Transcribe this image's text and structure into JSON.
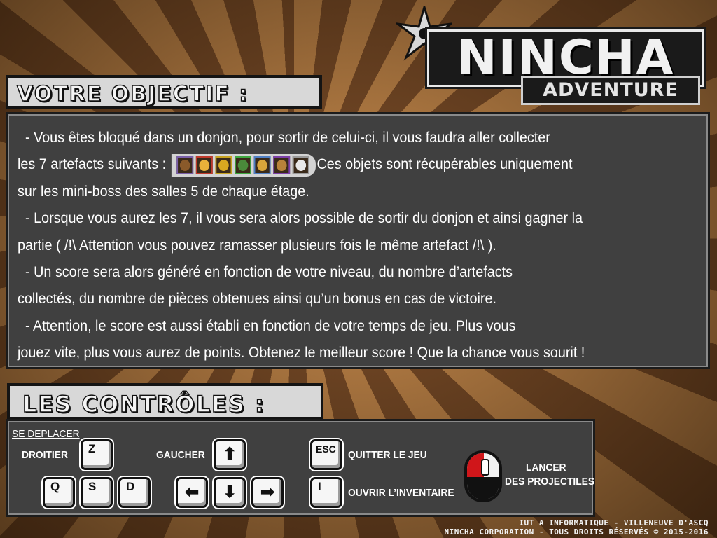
{
  "logo": {
    "title": "NINCHA",
    "subtitle": "ADVENTURE"
  },
  "objectif": {
    "heading": "VOTRE OBJECTIF :",
    "line1": "- Vous êtes bloqué dans un donjon, pour sortir de celui-ci, il vous faudra aller collecter",
    "line2_before": "les 7 artefacts suivants :",
    "line2_after": "Ces objets sont récupérables uniquement",
    "line3": "sur les mini-boss des salles 5 de chaque étage.",
    "line4": "- Lorsque vous aurez les 7, il vous sera alors possible de sortir du donjon et ainsi gagner la",
    "line5": "partie ( /!\\ Attention vous pouvez ramasser plusieurs fois le même artefact /!\\ ).",
    "line6": "- Un score sera alors généré en fonction de votre niveau, du nombre d’artefacts",
    "line7": "collectés, du nombre de pièces obtenues ainsi qu’un bonus en cas de victoire.",
    "line8": "- Attention, le score est aussi établi en fonction de votre temps de jeu. Plus vous",
    "line9": "jouez vite, plus vous aurez de points. Obtenez le meilleur score ! Que la chance vous sourit !",
    "artefacts": [
      {
        "icon": "teddy-bear-icon",
        "border": "#7a5fa8",
        "color": "#8a5a2a"
      },
      {
        "icon": "lantern-icon",
        "border": "#c0392b",
        "color": "#e8b13a"
      },
      {
        "icon": "key-icon",
        "border": "#c7a21f",
        "color": "#d8a820"
      },
      {
        "icon": "emblem-icon",
        "border": "#3fa73f",
        "color": "#4a8a3a"
      },
      {
        "icon": "crest-icon",
        "border": "#4f7fc4",
        "color": "#d9a53a"
      },
      {
        "icon": "rope-icon",
        "border": "#7c3fa8",
        "color": "#b8823a"
      },
      {
        "icon": "mask-icon",
        "border": "#9a9a9a",
        "color": "#e8e8e8"
      }
    ]
  },
  "controles": {
    "heading": "LES CONTRÔLES :",
    "move_label": "SE DEPLACER",
    "right_label": "DROITIER",
    "left_label": "GAUCHER",
    "quit_label": "QUITTER LE JEU",
    "inventory_label": "OUVRIR L’INVENTAIRE",
    "shoot_line1": "LANCER",
    "shoot_line2": "DES PROJECTILES",
    "keys": {
      "z": "Z",
      "q": "Q",
      "s": "S",
      "d": "D",
      "esc": "ESC",
      "i": "I",
      "up": "⬆",
      "left": "⬅",
      "down": "⬇",
      "right": "➡"
    }
  },
  "footer": {
    "line1": "IUT A INFORMATIQUE - VILLENEUVE D'ASCQ",
    "line2": "NINCHA CORPORATION - TOUS DROITS RÉSERVÉS © 2015-2016"
  }
}
